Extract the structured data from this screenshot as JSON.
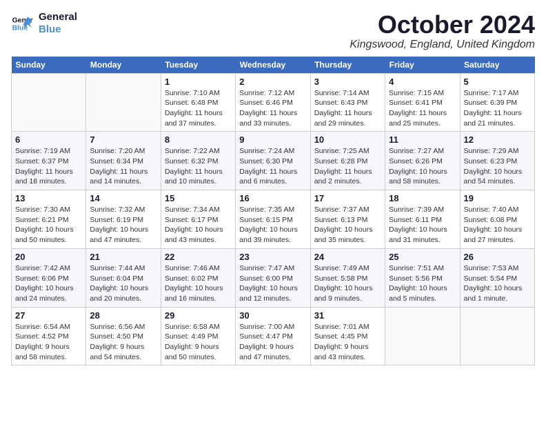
{
  "header": {
    "logo_line1": "General",
    "logo_line2": "Blue",
    "month_title": "October 2024",
    "location": "Kingswood, England, United Kingdom"
  },
  "weekdays": [
    "Sunday",
    "Monday",
    "Tuesday",
    "Wednesday",
    "Thursday",
    "Friday",
    "Saturday"
  ],
  "weeks": [
    [
      {
        "day": "",
        "detail": ""
      },
      {
        "day": "",
        "detail": ""
      },
      {
        "day": "1",
        "detail": "Sunrise: 7:10 AM\nSunset: 6:48 PM\nDaylight: 11 hours\nand 37 minutes."
      },
      {
        "day": "2",
        "detail": "Sunrise: 7:12 AM\nSunset: 6:46 PM\nDaylight: 11 hours\nand 33 minutes."
      },
      {
        "day": "3",
        "detail": "Sunrise: 7:14 AM\nSunset: 6:43 PM\nDaylight: 11 hours\nand 29 minutes."
      },
      {
        "day": "4",
        "detail": "Sunrise: 7:15 AM\nSunset: 6:41 PM\nDaylight: 11 hours\nand 25 minutes."
      },
      {
        "day": "5",
        "detail": "Sunrise: 7:17 AM\nSunset: 6:39 PM\nDaylight: 11 hours\nand 21 minutes."
      }
    ],
    [
      {
        "day": "6",
        "detail": "Sunrise: 7:19 AM\nSunset: 6:37 PM\nDaylight: 11 hours\nand 18 minutes."
      },
      {
        "day": "7",
        "detail": "Sunrise: 7:20 AM\nSunset: 6:34 PM\nDaylight: 11 hours\nand 14 minutes."
      },
      {
        "day": "8",
        "detail": "Sunrise: 7:22 AM\nSunset: 6:32 PM\nDaylight: 11 hours\nand 10 minutes."
      },
      {
        "day": "9",
        "detail": "Sunrise: 7:24 AM\nSunset: 6:30 PM\nDaylight: 11 hours\nand 6 minutes."
      },
      {
        "day": "10",
        "detail": "Sunrise: 7:25 AM\nSunset: 6:28 PM\nDaylight: 11 hours\nand 2 minutes."
      },
      {
        "day": "11",
        "detail": "Sunrise: 7:27 AM\nSunset: 6:26 PM\nDaylight: 10 hours\nand 58 minutes."
      },
      {
        "day": "12",
        "detail": "Sunrise: 7:29 AM\nSunset: 6:23 PM\nDaylight: 10 hours\nand 54 minutes."
      }
    ],
    [
      {
        "day": "13",
        "detail": "Sunrise: 7:30 AM\nSunset: 6:21 PM\nDaylight: 10 hours\nand 50 minutes."
      },
      {
        "day": "14",
        "detail": "Sunrise: 7:32 AM\nSunset: 6:19 PM\nDaylight: 10 hours\nand 47 minutes."
      },
      {
        "day": "15",
        "detail": "Sunrise: 7:34 AM\nSunset: 6:17 PM\nDaylight: 10 hours\nand 43 minutes."
      },
      {
        "day": "16",
        "detail": "Sunrise: 7:35 AM\nSunset: 6:15 PM\nDaylight: 10 hours\nand 39 minutes."
      },
      {
        "day": "17",
        "detail": "Sunrise: 7:37 AM\nSunset: 6:13 PM\nDaylight: 10 hours\nand 35 minutes."
      },
      {
        "day": "18",
        "detail": "Sunrise: 7:39 AM\nSunset: 6:11 PM\nDaylight: 10 hours\nand 31 minutes."
      },
      {
        "day": "19",
        "detail": "Sunrise: 7:40 AM\nSunset: 6:08 PM\nDaylight: 10 hours\nand 27 minutes."
      }
    ],
    [
      {
        "day": "20",
        "detail": "Sunrise: 7:42 AM\nSunset: 6:06 PM\nDaylight: 10 hours\nand 24 minutes."
      },
      {
        "day": "21",
        "detail": "Sunrise: 7:44 AM\nSunset: 6:04 PM\nDaylight: 10 hours\nand 20 minutes."
      },
      {
        "day": "22",
        "detail": "Sunrise: 7:46 AM\nSunset: 6:02 PM\nDaylight: 10 hours\nand 16 minutes."
      },
      {
        "day": "23",
        "detail": "Sunrise: 7:47 AM\nSunset: 6:00 PM\nDaylight: 10 hours\nand 12 minutes."
      },
      {
        "day": "24",
        "detail": "Sunrise: 7:49 AM\nSunset: 5:58 PM\nDaylight: 10 hours\nand 9 minutes."
      },
      {
        "day": "25",
        "detail": "Sunrise: 7:51 AM\nSunset: 5:56 PM\nDaylight: 10 hours\nand 5 minutes."
      },
      {
        "day": "26",
        "detail": "Sunrise: 7:53 AM\nSunset: 5:54 PM\nDaylight: 10 hours\nand 1 minute."
      }
    ],
    [
      {
        "day": "27",
        "detail": "Sunrise: 6:54 AM\nSunset: 4:52 PM\nDaylight: 9 hours\nand 58 minutes."
      },
      {
        "day": "28",
        "detail": "Sunrise: 6:56 AM\nSunset: 4:50 PM\nDaylight: 9 hours\nand 54 minutes."
      },
      {
        "day": "29",
        "detail": "Sunrise: 6:58 AM\nSunset: 4:49 PM\nDaylight: 9 hours\nand 50 minutes."
      },
      {
        "day": "30",
        "detail": "Sunrise: 7:00 AM\nSunset: 4:47 PM\nDaylight: 9 hours\nand 47 minutes."
      },
      {
        "day": "31",
        "detail": "Sunrise: 7:01 AM\nSunset: 4:45 PM\nDaylight: 9 hours\nand 43 minutes."
      },
      {
        "day": "",
        "detail": ""
      },
      {
        "day": "",
        "detail": ""
      }
    ]
  ]
}
